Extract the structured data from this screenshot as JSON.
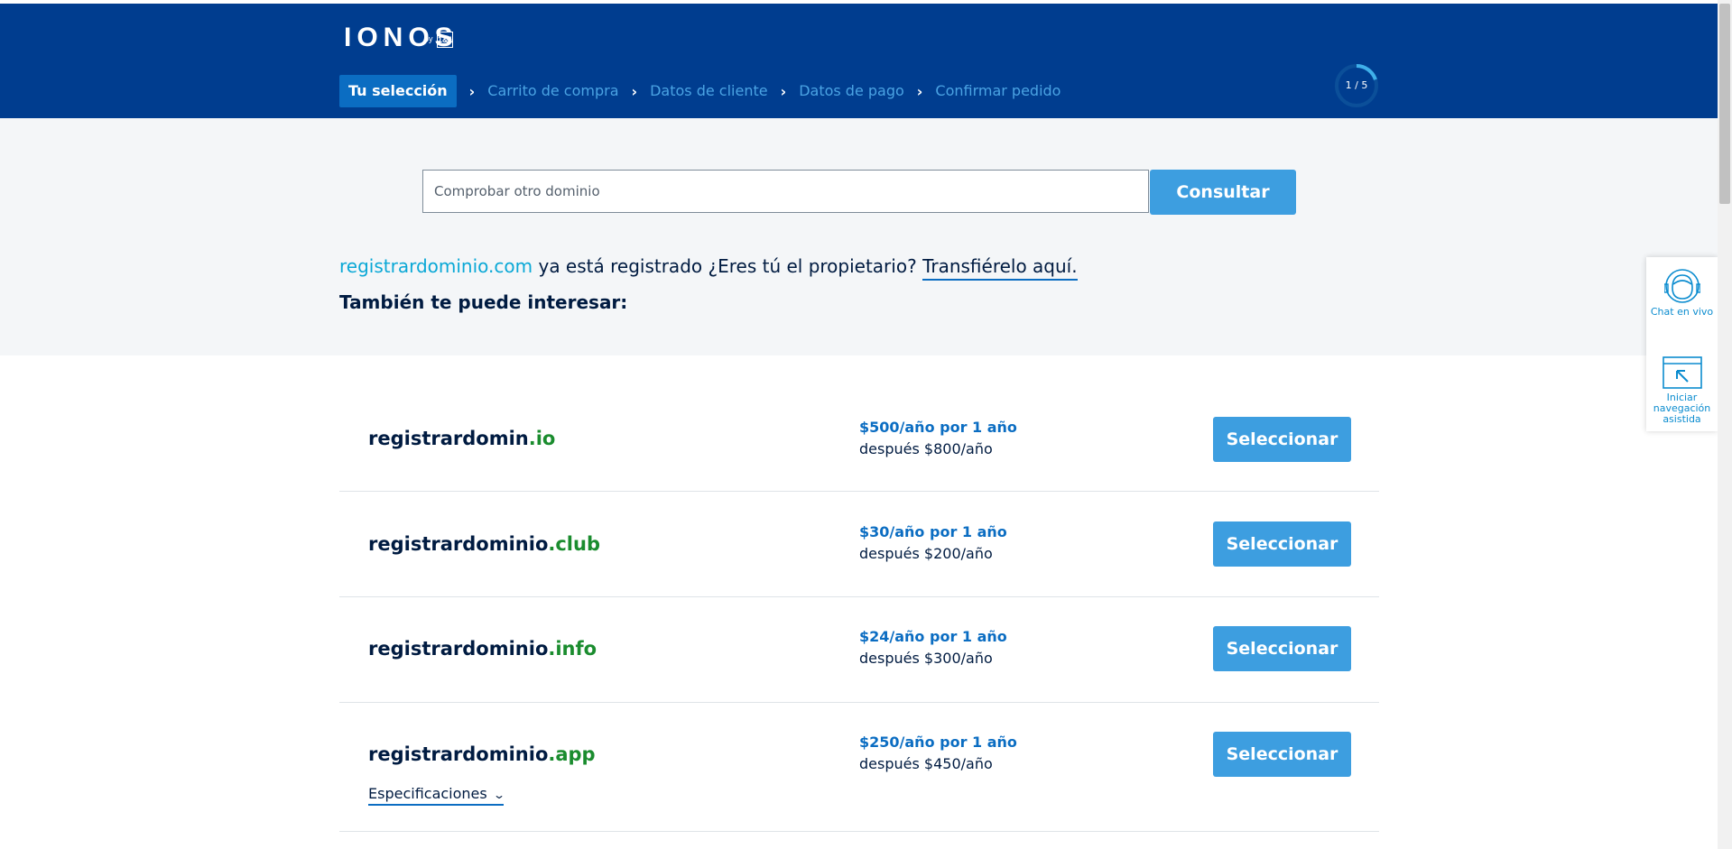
{
  "header": {
    "logo_text": "IONOS",
    "logo_by": "by",
    "logo_brand": "1&1",
    "steps": [
      {
        "label": "Tu selección",
        "active": true
      },
      {
        "label": "Carrito de compra",
        "active": false
      },
      {
        "label": "Datos de cliente",
        "active": false
      },
      {
        "label": "Datos de pago",
        "active": false
      },
      {
        "label": "Confirmar pedido",
        "active": false
      }
    ],
    "progress_text": "1 / 5",
    "progress_fraction": 0.2
  },
  "search": {
    "placeholder": "Comprobar otro dominio",
    "button_label": "Consultar"
  },
  "message": {
    "domain": "registrardominio.com",
    "text": " ya está registrado ¿Eres tú el propietario? ",
    "transfer_link": "Transfiérelo aquí.",
    "interest": "También te puede interesar:"
  },
  "results": [
    {
      "name": "registrardomin",
      "tld": ".io",
      "price": "$500/año por 1 año",
      "after": "después $800/año",
      "button": "Seleccionar"
    },
    {
      "name": "registrardominio",
      "tld": ".club",
      "price": "$30/año por 1 año",
      "after": "después $200/año",
      "button": "Seleccionar"
    },
    {
      "name": "registrardominio",
      "tld": ".info",
      "price": "$24/año por 1 año",
      "after": "después $300/año",
      "button": "Seleccionar"
    },
    {
      "name": "registrardominio",
      "tld": ".app",
      "price": "$250/año por 1 año",
      "after": "después $450/año",
      "button": "Seleccionar",
      "specs": "Especificaciones"
    }
  ],
  "side_widget": {
    "chat_label": "Chat en vivo",
    "nav_label": "Iniciar navegación asistida"
  },
  "colors": {
    "header_bg": "#003d8f",
    "button_bg": "#3d9ee0",
    "tld_green": "#1a8c2e",
    "link_blue": "#0b6dc2"
  }
}
